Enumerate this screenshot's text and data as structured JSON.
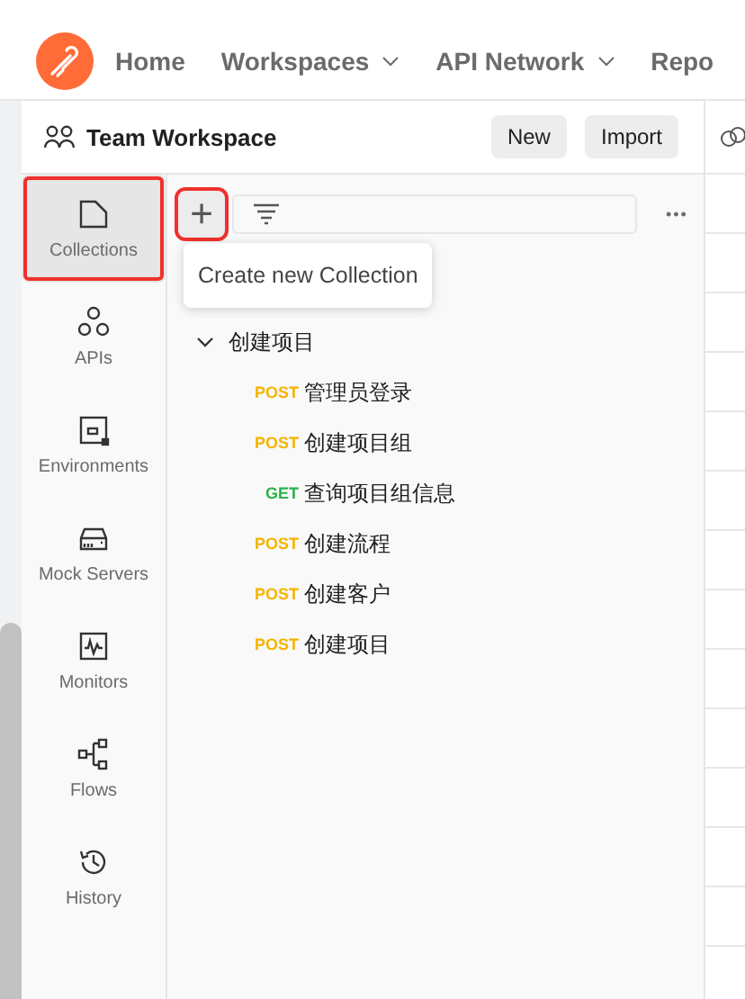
{
  "header": {
    "nav": [
      {
        "label": "Home",
        "dropdown": false
      },
      {
        "label": "Workspaces",
        "dropdown": true
      },
      {
        "label": "API Network",
        "dropdown": true
      },
      {
        "label": "Repo",
        "dropdown": false
      }
    ]
  },
  "workspace": {
    "title": "Team Workspace",
    "buttons": [
      "New",
      "Import"
    ]
  },
  "sidebar": {
    "items": [
      {
        "label": "Collections",
        "kind": "collections",
        "selected": true,
        "highlighted": true
      },
      {
        "label": "APIs",
        "kind": "apis",
        "selected": false,
        "highlighted": false
      },
      {
        "label": "Environments",
        "kind": "environments",
        "selected": false,
        "highlighted": false
      },
      {
        "label": "Mock Servers",
        "kind": "mock",
        "selected": false,
        "highlighted": false
      },
      {
        "label": "Monitors",
        "kind": "monitors",
        "selected": false,
        "highlighted": false
      },
      {
        "label": "Flows",
        "kind": "flows",
        "selected": false,
        "highlighted": false
      },
      {
        "label": "History",
        "kind": "history",
        "selected": false,
        "highlighted": false
      }
    ]
  },
  "toolbar": {
    "add_button": {
      "symbol": "+",
      "highlighted": true
    },
    "more": "•••"
  },
  "tooltip": "Create new Collection",
  "tree": [
    {
      "name": "创建项目",
      "expanded": true,
      "children": [
        {
          "method": "POST",
          "name": "管理员登录"
        },
        {
          "method": "POST",
          "name": "创建项目组"
        },
        {
          "method": "GET",
          "name": "查询项目组信息"
        },
        {
          "method": "POST",
          "name": "创建流程"
        },
        {
          "method": "POST",
          "name": "创建客户"
        },
        {
          "method": "POST",
          "name": "创建项目"
        }
      ]
    }
  ]
}
